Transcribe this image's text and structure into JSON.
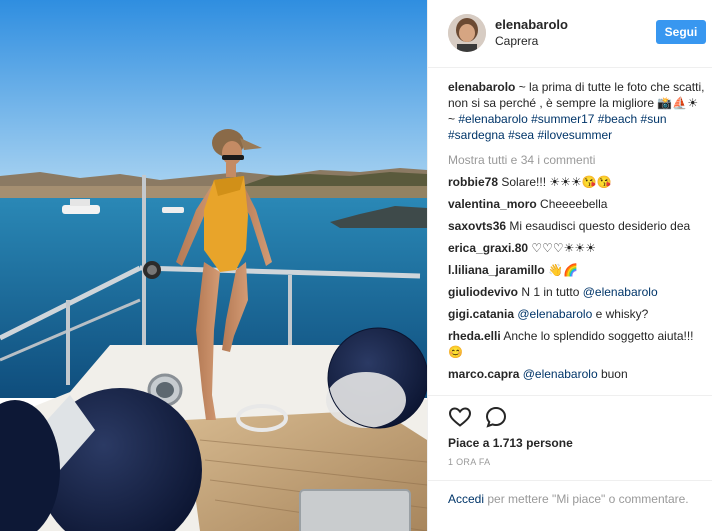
{
  "post": {
    "username": "elenabarolo",
    "location": "Caprera",
    "follow_label": "Segui",
    "caption": {
      "username": "elenabarolo",
      "text": " ~ la prima di tutte le foto che scatti, non si sa perché , è sempre la migliore 📸⛵☀ ~ ",
      "hashtags": [
        "#elenabarolo",
        "#summer17",
        "#beach",
        "#sun",
        "#sardegna",
        "#sea",
        "#ilovesummer"
      ]
    },
    "show_all_comments": "Mostra tutti e 34 i commenti",
    "comments": [
      {
        "user": "robbie78",
        "text": "Solare!!! ☀☀☀😘😘"
      },
      {
        "user": "valentina_moro",
        "text": "Cheeeebella"
      },
      {
        "user": "saxovts36",
        "text": "Mi esaudisci questo desiderio dea"
      },
      {
        "user": "erica_graxi.80",
        "text": "♡♡♡☀☀☀"
      },
      {
        "user": "l.liliana_jaramillo",
        "text": "👋🌈"
      },
      {
        "user": "giuliodevivo",
        "text": "N 1 in tutto ",
        "mention": "@elenabarolo",
        "after": ""
      },
      {
        "user": "gigi.catania",
        "text": "",
        "mention": "@elenabarolo",
        "after": " e whisky?"
      },
      {
        "user": "rheda.elli",
        "text": "Anche lo splendido soggetto aiuta!!!😊"
      },
      {
        "user": "marco.capra",
        "text": "",
        "mention": "@elenabarolo",
        "after": " buon"
      }
    ],
    "likes": "Piace a 1.713 persone",
    "time": "1 ORA FA",
    "add_comment": {
      "login_link": "Accedi",
      "text": " per mettere \"Mi piace\" o commentare."
    },
    "icons": {
      "like": "heart-outline-icon",
      "comment": "speech-bubble-icon"
    },
    "colors": {
      "accent": "#3897f0",
      "link": "#003569",
      "muted": "#999999",
      "text": "#262626"
    }
  }
}
